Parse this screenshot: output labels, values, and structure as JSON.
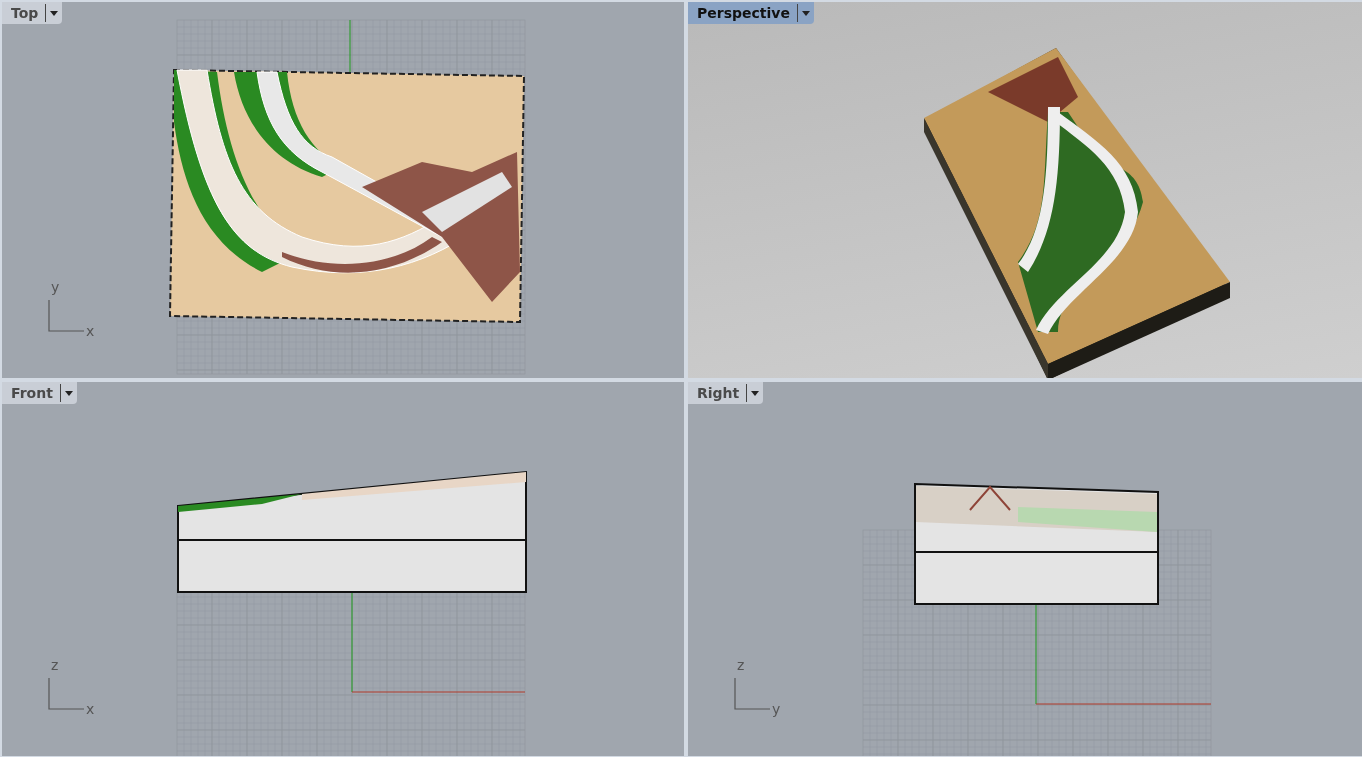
{
  "viewports": [
    {
      "title": "Top",
      "selected": false,
      "kind": "top",
      "axes": [
        "y",
        "x"
      ]
    },
    {
      "title": "Perspective",
      "selected": true,
      "kind": "perspective"
    },
    {
      "title": "Front",
      "selected": false,
      "kind": "front",
      "axes": [
        "z",
        "x"
      ]
    },
    {
      "title": "Right",
      "selected": false,
      "kind": "right",
      "axes": [
        "z",
        "y"
      ]
    }
  ]
}
